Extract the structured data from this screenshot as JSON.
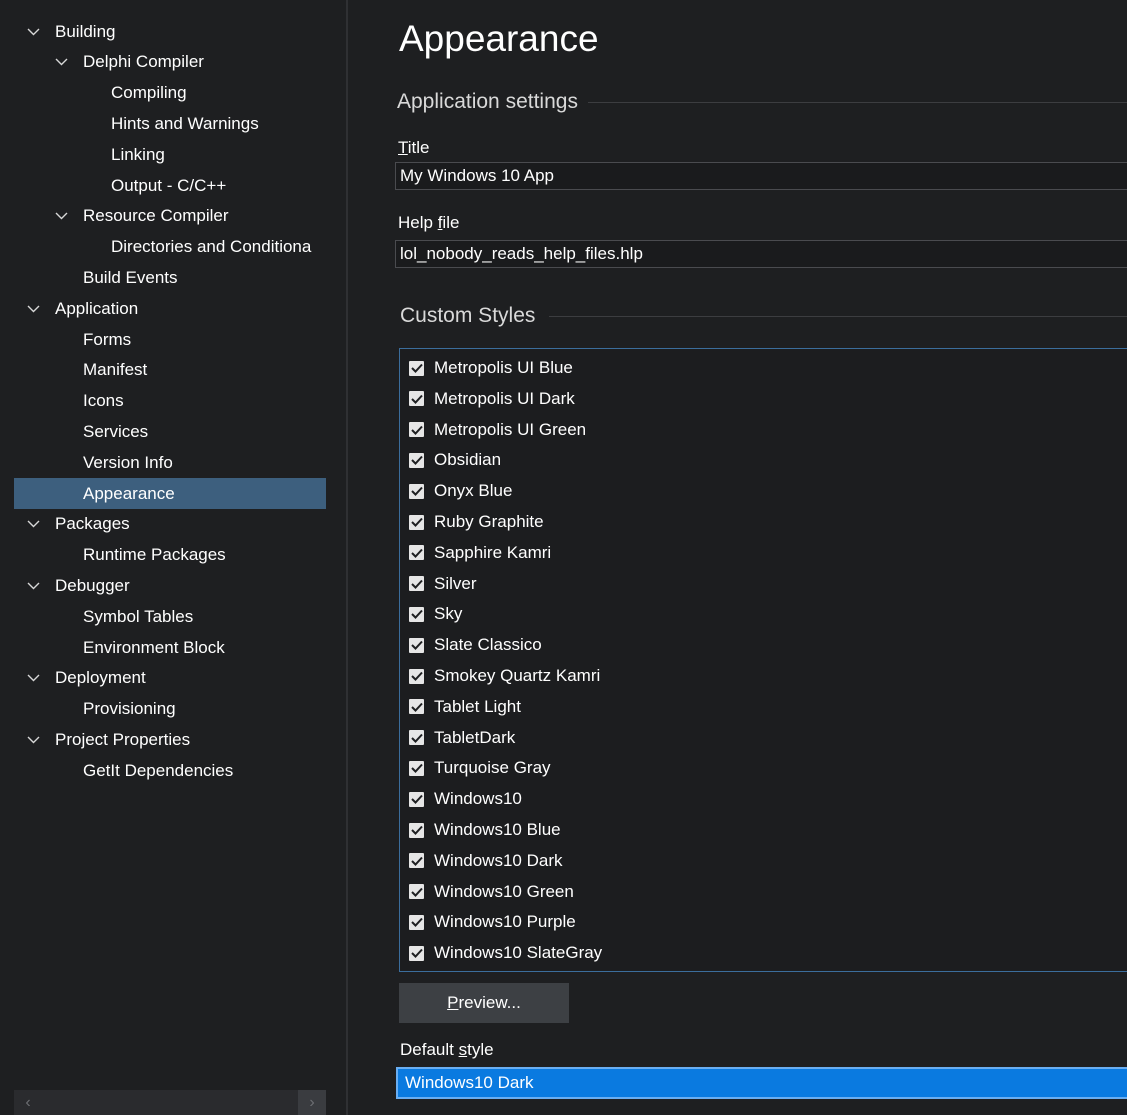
{
  "sidebar": {
    "items": [
      {
        "label": "Building",
        "level": 0,
        "expandable": true
      },
      {
        "label": "Delphi Compiler",
        "level": 1,
        "expandable": true
      },
      {
        "label": "Compiling",
        "level": 2,
        "expandable": false
      },
      {
        "label": "Hints and Warnings",
        "level": 2,
        "expandable": false
      },
      {
        "label": "Linking",
        "level": 2,
        "expandable": false
      },
      {
        "label": "Output - C/C++",
        "level": 2,
        "expandable": false
      },
      {
        "label": "Resource Compiler",
        "level": 1,
        "expandable": true
      },
      {
        "label": "Directories and Conditiona",
        "level": 2,
        "expandable": false
      },
      {
        "label": "Build Events",
        "level": 1,
        "expandable": false
      },
      {
        "label": "Application",
        "level": 0,
        "expandable": true
      },
      {
        "label": "Forms",
        "level": 1,
        "expandable": false
      },
      {
        "label": "Manifest",
        "level": 1,
        "expandable": false
      },
      {
        "label": "Icons",
        "level": 1,
        "expandable": false
      },
      {
        "label": "Services",
        "level": 1,
        "expandable": false
      },
      {
        "label": "Version Info",
        "level": 1,
        "expandable": false
      },
      {
        "label": "Appearance",
        "level": 1,
        "expandable": false,
        "selected": true
      },
      {
        "label": "Packages",
        "level": 0,
        "expandable": true
      },
      {
        "label": "Runtime Packages",
        "level": 1,
        "expandable": false
      },
      {
        "label": "Debugger",
        "level": 0,
        "expandable": true
      },
      {
        "label": "Symbol Tables",
        "level": 1,
        "expandable": false
      },
      {
        "label": "Environment Block",
        "level": 1,
        "expandable": false
      },
      {
        "label": "Deployment",
        "level": 0,
        "expandable": true
      },
      {
        "label": "Provisioning",
        "level": 1,
        "expandable": false
      },
      {
        "label": "Project Properties",
        "level": 0,
        "expandable": true
      },
      {
        "label": "GetIt Dependencies",
        "level": 1,
        "expandable": false
      }
    ],
    "scroll_left_icon": "chevron-left-icon",
    "scroll_right_icon": "chevron-right-icon"
  },
  "main": {
    "title": "Appearance",
    "application_settings": {
      "header": "Application settings",
      "title_label_underlined": "T",
      "title_label_rest": "itle",
      "title_value": "My Windows 10 App",
      "help_label_prefix": "Help ",
      "help_label_underlined": "f",
      "help_label_rest": "ile",
      "help_value": "lol_nobody_reads_help_files.hlp"
    },
    "custom_styles": {
      "header": "Custom Styles",
      "items": [
        {
          "label": "Metropolis UI Blue",
          "checked": true
        },
        {
          "label": "Metropolis UI Dark",
          "checked": true
        },
        {
          "label": "Metropolis UI Green",
          "checked": true
        },
        {
          "label": "Obsidian",
          "checked": true
        },
        {
          "label": "Onyx Blue",
          "checked": true
        },
        {
          "label": "Ruby Graphite",
          "checked": true
        },
        {
          "label": "Sapphire Kamri",
          "checked": true
        },
        {
          "label": "Silver",
          "checked": true
        },
        {
          "label": "Sky",
          "checked": true
        },
        {
          "label": "Slate Classico",
          "checked": true
        },
        {
          "label": "Smokey Quartz Kamri",
          "checked": true
        },
        {
          "label": "Tablet Light",
          "checked": true
        },
        {
          "label": "TabletDark",
          "checked": true
        },
        {
          "label": "Turquoise Gray",
          "checked": true
        },
        {
          "label": "Windows10",
          "checked": true
        },
        {
          "label": "Windows10 Blue",
          "checked": true
        },
        {
          "label": "Windows10 Dark",
          "checked": true
        },
        {
          "label": "Windows10 Green",
          "checked": true
        },
        {
          "label": "Windows10 Purple",
          "checked": true
        },
        {
          "label": "Windows10 SlateGray",
          "checked": true
        }
      ],
      "preview_underlined": "P",
      "preview_rest": "review...",
      "default_label_prefix": "Default ",
      "default_label_underlined": "s",
      "default_label_rest": "tyle",
      "default_value": "Windows10 Dark"
    }
  },
  "colors": {
    "background": "#1e1f21",
    "selection": "#3d5f7e",
    "accent": "#0a7ae0"
  }
}
